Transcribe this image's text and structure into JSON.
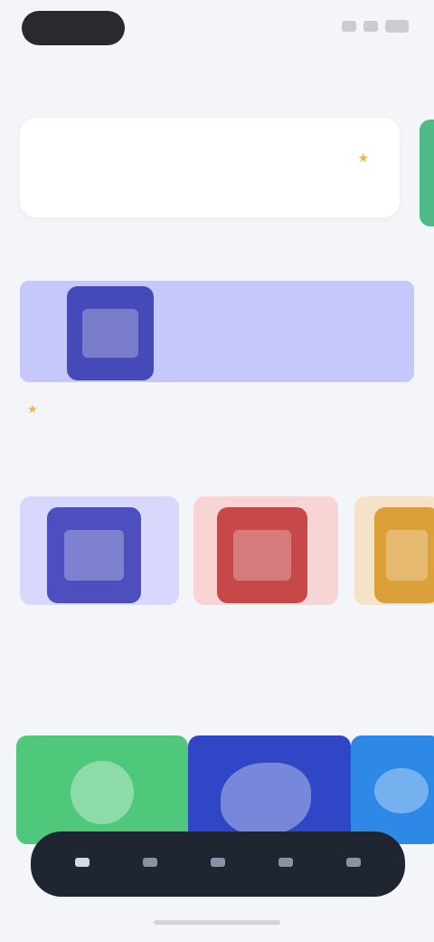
{
  "status_bar": {
    "time": ""
  },
  "page_title": "",
  "hero": {
    "title": "",
    "subtitle": "",
    "stat": ""
  },
  "sections": {
    "featured": {
      "title": "",
      "link": ""
    },
    "popular": {
      "title": ""
    },
    "categories": {
      "title": ""
    }
  },
  "featured_game": {
    "rating": "",
    "name": "",
    "description": ""
  },
  "popular_games": [
    {
      "name": "",
      "rating": "",
      "sub": ""
    },
    {
      "name": "",
      "rating": "",
      "sub": ""
    },
    {
      "name": "",
      "rating": "",
      "sub": ""
    }
  ],
  "tabs": [
    {
      "label": "",
      "active": true
    },
    {
      "label": "",
      "active": false
    },
    {
      "label": "",
      "active": false
    },
    {
      "label": "",
      "active": false
    },
    {
      "label": "",
      "active": false
    }
  ],
  "colors": {
    "featured_banner": "#c6c7fb",
    "tile_purple": "#4d4fbe",
    "tile_red": "#c74848",
    "tile_amber": "#dba03a",
    "cat_green": "#4fc87c",
    "cat_blue": "#2f47c6",
    "cat_sky": "#2d88e6",
    "tab_bar": "#1f2632",
    "accent_green": "#4fb98a"
  }
}
